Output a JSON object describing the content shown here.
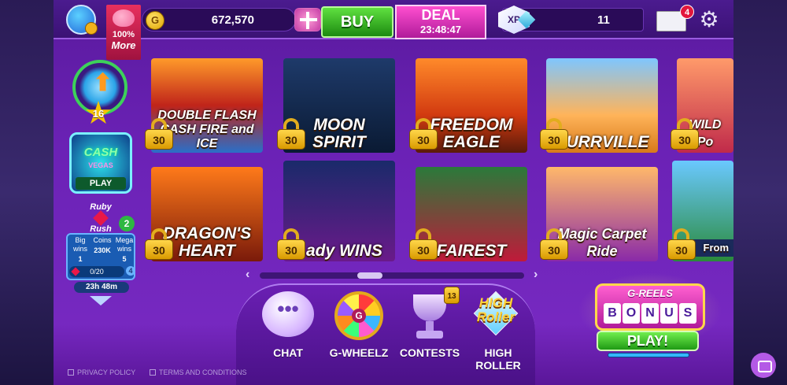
{
  "topbar": {
    "piggy_line1": "100%",
    "piggy_line2": "More",
    "coins": "672,570",
    "coin_icon_letter": "G",
    "buy_label": "BUY",
    "deal_label": "DEAL",
    "deal_timer": "23:48:47",
    "xp_label": "XP",
    "xp_value": "11",
    "mail_count": "4"
  },
  "left": {
    "level": "16",
    "cash_vegas_title": "CASH",
    "cash_vegas_sub": "VEGAS",
    "cash_vegas_play": "PLAY",
    "ruby_rush_line1": "Ruby",
    "ruby_rush_line2": "Rush",
    "ruby_rush_badge": "2",
    "stats": [
      {
        "label": "Big wins",
        "value": "1"
      },
      {
        "label": "Coins",
        "value": "230K"
      },
      {
        "label": "Mega wins",
        "value": "5"
      }
    ],
    "progress": "0/20",
    "progress_badge": "4",
    "timer": "23h 48m"
  },
  "games": [
    {
      "title": "DOUBLE FLASH CASH FIRE and ICE",
      "lock": "30"
    },
    {
      "title": "MOON SPIRIT",
      "lock": "30"
    },
    {
      "title": "FREEDOM EAGLE",
      "lock": "30"
    },
    {
      "title": "PURRVILLE",
      "lock": "30"
    },
    {
      "title": "WILD Po",
      "lock": "30"
    },
    {
      "title": "DRAGON'S HEART",
      "lock": "30"
    },
    {
      "title": "Lady WINS",
      "lock": "30"
    },
    {
      "title": "FAIREST",
      "lock": "30"
    },
    {
      "title": "Magic Carpet Ride",
      "lock": "30"
    },
    {
      "title": "From",
      "lock": "30"
    }
  ],
  "nav": {
    "chat": "CHAT",
    "wheel": "G-WHEELZ",
    "contests": "CONTESTS",
    "contests_lock": "13",
    "high_roller": "HIGH ROLLER",
    "high_roller_logo": "HIGH Roller"
  },
  "greels": {
    "title": "G-REELS",
    "bonus_letters": [
      "B",
      "O",
      "N",
      "U",
      "S"
    ],
    "play": "PLAY!"
  },
  "footer": {
    "privacy": "PRIVACY POLICY",
    "terms": "TERMS AND CONDITIONS"
  },
  "colors": {
    "accent_purple": "#6b22b6",
    "buy_green": "#1c8a10",
    "deal_pink": "#b01b9a",
    "lock_gold": "#ffd64a"
  }
}
